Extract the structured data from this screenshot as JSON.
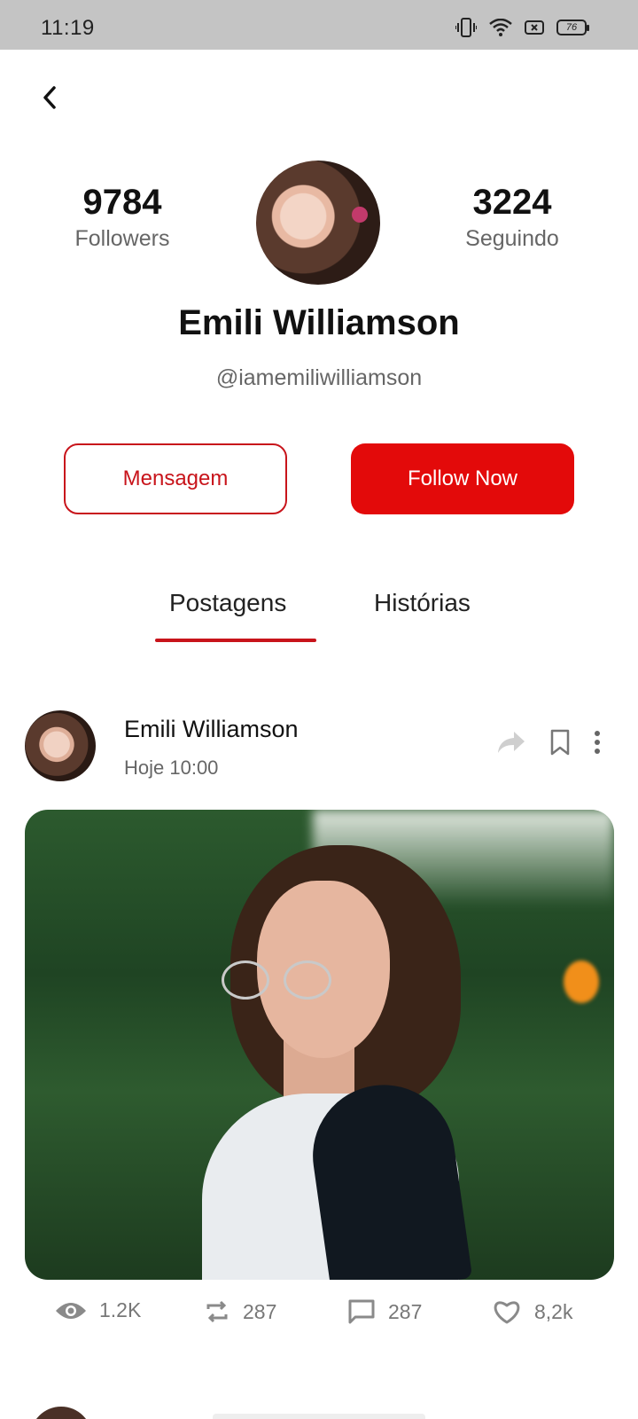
{
  "status_bar": {
    "time": "11:19",
    "battery": "76"
  },
  "profile": {
    "followers_count": "9784",
    "followers_label": "Followers",
    "following_count": "3224",
    "following_label": "Seguindo",
    "name": "Emili Williamson",
    "handle": "@iamemiliwilliamson"
  },
  "actions": {
    "message_label": "Mensagem",
    "follow_label": "Follow Now"
  },
  "tabs": [
    {
      "label": "Postagens",
      "active": true
    },
    {
      "label": "Histórias",
      "active": false
    }
  ],
  "post": {
    "author": "Emili Williamson",
    "time": "Hoje 10:00",
    "metrics": {
      "views": "1.2K",
      "reposts": "287",
      "comments": "287",
      "likes": "8,2k"
    }
  },
  "colors": {
    "accent": "#e30a0a",
    "accent_border": "#c8141b",
    "status_bar": "#c4c4c4"
  }
}
